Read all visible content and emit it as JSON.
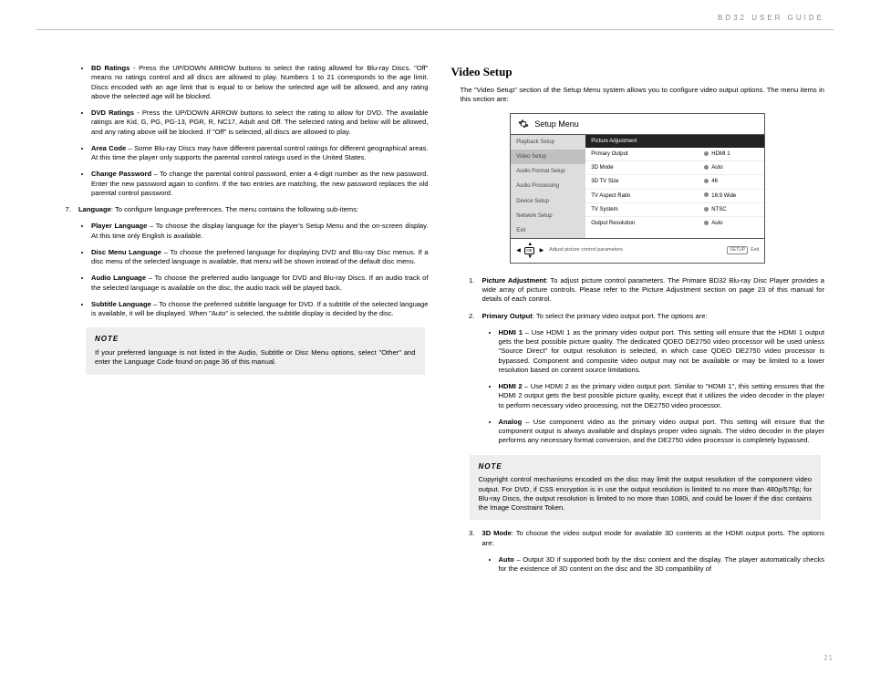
{
  "header": "BD32 USER GUIDE",
  "page_number": "21",
  "left": {
    "bullets_top": [
      {
        "label": "BD Ratings",
        "text": " - Press the UP/DOWN ARROW buttons to select the rating allowed for Blu-ray Discs. \"Off\" means no ratings control and all discs are allowed to play. Numbers 1 to 21 corresponds to the age limit. Discs encoded with an age limit that is equal to or below the selected age will be allowed, and any rating above the selected age will be blocked."
      },
      {
        "label": "DVD Ratings",
        "text": " - Press the UP/DOWN ARROW buttons to select the rating to allow for DVD. The available ratings are Kid, G, PG, PG-13, PGR, R, NC17, Adult and Off. The selected rating and below will be allowed, and any rating above will be blocked. If \"Off\" is selected, all discs are allowed to play."
      },
      {
        "label": "Area Code",
        "text": " – Some Blu-ray Discs may have different parental control ratings for different geographical areas. At this time the player only supports the parental control ratings used in the United States."
      },
      {
        "label": "Change Password",
        "text": " – To change the parental control password, enter a 4-digit number as the new password. Enter the new password again to confirm. If the two entries are matching, the new password replaces the old parental control password."
      }
    ],
    "num7_label": "Language",
    "num7_text": ": To configure language preferences. The menu contains the following sub-items:",
    "lang_bullets": [
      {
        "label": "Player Language",
        "text": " – To choose the display language for the player's Setup Menu and the on-screen display. At this time only English is available."
      },
      {
        "label": "Disc Menu Language",
        "text": " – To choose the preferred language for displaying DVD and Blu-ray Disc menus. If a disc menu of the selected language is available, that menu will be shown instead of the default disc menu."
      },
      {
        "label": "Audio Language",
        "text": " – To choose the preferred audio language for DVD and Blu-ray Discs. If an audio track of the selected language is available on the disc, the audio track will be played back."
      },
      {
        "label": "Subtitle Language",
        "text": " – To choose the preferred subtitle language for DVD. If a subtitle of the selected language is available, it will be displayed. When \"Auto\" is selected, the subtitle display is decided by the disc."
      }
    ],
    "note_label": "NOTE",
    "note_text": "If your preferred language is not listed in the Audio, Subtitle or Disc Menu options, select \"Other\" and enter the Language Code found on page 36 of this manual."
  },
  "right": {
    "heading": "Video Setup",
    "intro": "The \"Video Setup\" section of the Setup Menu system allows you to configure video output options. The menu items in this section are:",
    "setup_menu": {
      "title": "Setup Menu",
      "left_items": [
        "Playback Setup",
        "Video Setup",
        "Audio Format Setup",
        "Audio Processing",
        "Device Setup",
        "Network Setup",
        "Exit"
      ],
      "header_item": "Picture Adjustment",
      "rows": [
        {
          "l": "Primary Output",
          "v": "HDMI 1"
        },
        {
          "l": "3D Mode",
          "v": "Auto"
        },
        {
          "l": "3D TV Size",
          "v": "46"
        },
        {
          "l": "TV Aspect Ratio",
          "v": "16:9 Wide"
        },
        {
          "l": "TV System",
          "v": "NTSC"
        },
        {
          "l": "Output Resolution",
          "v": "Auto"
        }
      ],
      "footer_hint": "Adjust picture control parameters",
      "footer_setup": "SETUP",
      "footer_exit": "Exit",
      "ok": "OK"
    },
    "ol": [
      {
        "label": "Picture Adjustment",
        "text": ": To adjust picture control parameters. The Primare BD32 Blu-ray Disc Player provides a wide array of picture controls. Please refer to the Picture Adjustment section on page 23 of this manual for details of each control."
      },
      {
        "label": "Primary Output",
        "text": ": To select the primary video output port. The options are:",
        "sub": [
          {
            "label": "HDMI 1",
            "text": " – Use HDMI 1 as the primary video output port. This setting will ensure that the HDMI 1 output gets the best possible picture quality. The dedicated QDEO DE2750 video processor will be used unless \"Source Direct\" for output resolution is selected, in which case QDEO DE2750 video processor is bypassed. Component and composite video output may not be available or may be limited to a lower resolution based on content source limitations."
          },
          {
            "label": "HDMI 2",
            "text": " – Use HDMI 2 as the primary video output port. Similar to \"HDMI 1\", this setting ensures that the HDMI 2 output gets the best possible picture quality, except that it utilizes the video decoder in the player to perform necessary video processing, not the DE2750 video processor."
          },
          {
            "label": "Analog",
            "text": " – Use component video as the primary video output port. This setting will ensure that the component output is always available and displays proper video signals. The video decoder in the player performs any necessary format conversion, and the DE2750 video processor is completely bypassed."
          }
        ]
      }
    ],
    "note_label": "NOTE",
    "note_text": "Copyright control mechanisms encoded on the disc may limit the output resolution of the component video output. For DVD, if CSS encryption is in use the output resolution is limited to no more than 480p/576p; for Blu-ray Discs, the output resolution is limited to no more than 1080i, and could be lower if the disc contains the Image Constraint Token.",
    "item3_label": "3D Mode",
    "item3_text": ": To choose the video output mode for available 3D contents at the HDMI output ports. The options are:",
    "item3_sub": [
      {
        "label": "Auto",
        "text": " – Output 3D if supported both by the disc content and the display. The player automatically checks for the existence of 3D content on the disc and the 3D compatibility of"
      }
    ]
  }
}
